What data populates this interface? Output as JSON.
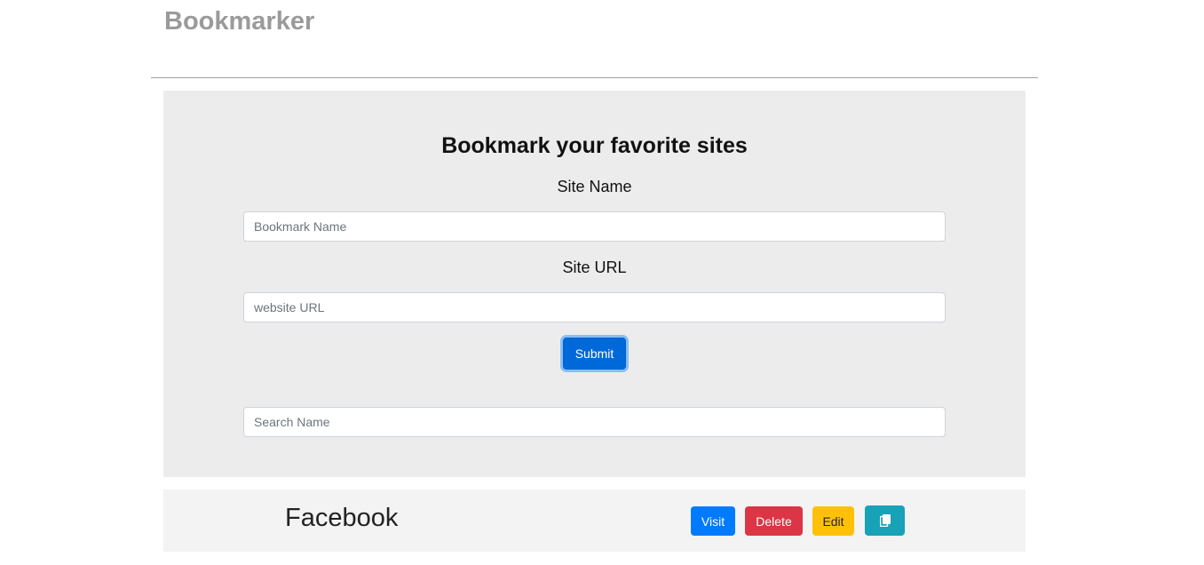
{
  "header": {
    "brand": "Bookmarker"
  },
  "form": {
    "title": "Bookmark your favorite sites",
    "site_name_label": "Site Name",
    "site_name_placeholder": "Bookmark Name",
    "site_url_label": "Site URL",
    "site_url_placeholder": "website URL",
    "submit_label": "Submit",
    "search_placeholder": "Search Name"
  },
  "bookmarks": [
    {
      "name": "Facebook",
      "visit_label": "Visit",
      "delete_label": "Delete",
      "edit_label": "Edit",
      "copy_icon": "copy-icon"
    }
  ],
  "colors": {
    "brand_text": "#9a9a9a",
    "panel_bg": "#ececec",
    "primary": "#007bff",
    "submit": "#0069d9",
    "danger": "#dc3545",
    "warning": "#ffc107",
    "info": "#17a2b8"
  }
}
